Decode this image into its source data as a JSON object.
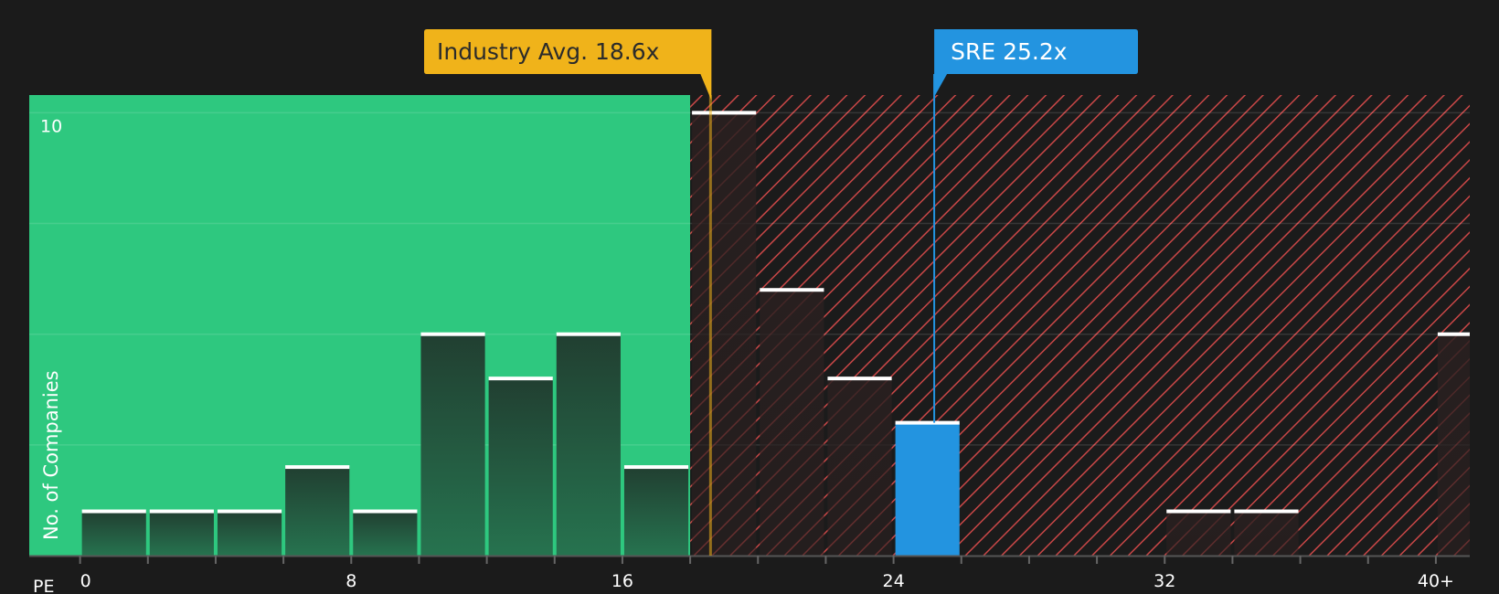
{
  "chart_data": {
    "type": "bar",
    "xlabel": "PE",
    "ylabel": "No. of Companies",
    "xlim": [
      -1.5,
      41
    ],
    "ylim": [
      0,
      10.4
    ],
    "x_tick_labels": [
      {
        "value": 0,
        "label": "0"
      },
      {
        "value": 8,
        "label": "8"
      },
      {
        "value": 16,
        "label": "16"
      },
      {
        "value": 24,
        "label": "24"
      },
      {
        "value": 32,
        "label": "32"
      },
      {
        "value": 40,
        "label": "40+"
      }
    ],
    "x_minor_ticks": [
      0,
      2,
      4,
      6,
      8,
      10,
      12,
      14,
      16,
      18,
      20,
      22,
      24,
      26,
      28,
      30,
      32,
      34,
      36,
      38,
      40
    ],
    "y_tick_labels": [
      {
        "value": 10,
        "label": "10"
      }
    ],
    "y_gridlines": [
      2.5,
      5,
      7.5,
      10
    ],
    "bin_width": 2,
    "bins": [
      {
        "x": 0,
        "value": 1
      },
      {
        "x": 2,
        "value": 1
      },
      {
        "x": 4,
        "value": 1
      },
      {
        "x": 6,
        "value": 2
      },
      {
        "x": 8,
        "value": 1
      },
      {
        "x": 10,
        "value": 5
      },
      {
        "x": 12,
        "value": 4
      },
      {
        "x": 14,
        "value": 5
      },
      {
        "x": 16,
        "value": 2
      },
      {
        "x": 18,
        "value": 10
      },
      {
        "x": 20,
        "value": 6
      },
      {
        "x": 22,
        "value": 4
      },
      {
        "x": 24,
        "value": 3,
        "highlight": true
      },
      {
        "x": 26,
        "value": 0
      },
      {
        "x": 28,
        "value": 0
      },
      {
        "x": 30,
        "value": 0
      },
      {
        "x": 32,
        "value": 1
      },
      {
        "x": 34,
        "value": 1
      },
      {
        "x": 36,
        "value": 0
      },
      {
        "x": 38,
        "value": 0
      },
      {
        "x": 40,
        "value": 5
      }
    ],
    "fair_region_end": 18,
    "industry_avg": {
      "value": 18.6,
      "label": "Industry Avg. 18.6x"
    },
    "company": {
      "value": 25.2,
      "label": "SRE 25.2x"
    },
    "grid": true,
    "legend": "none"
  },
  "colors": {
    "background": "#1b1b1b",
    "fair_region": "#2ec87f",
    "over_region_stripe": "#c94747",
    "bar_fill_top": "#213f31",
    "bar_fill_bottom": "#26734f",
    "bar_cap": "#ffffff",
    "industry_accent": "#f0b31a",
    "company_accent": "#2394e0",
    "axis_text": "#ffffff"
  }
}
